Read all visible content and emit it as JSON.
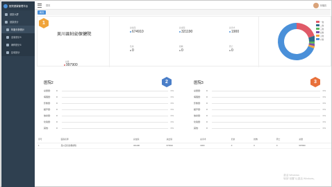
{
  "app": {
    "title": "医院健康管理平台"
  },
  "sidebar": {
    "items": [
      {
        "label": "健康大屏",
        "type": "top"
      },
      {
        "label": "健康统计",
        "type": "top"
      },
      {
        "label": "年度分析统计",
        "type": "sub",
        "active": true
      },
      {
        "label": "全量统计5",
        "type": "sub"
      },
      {
        "label": "病种统计6",
        "type": "sub"
      },
      {
        "label": "区域统计",
        "type": "sub"
      }
    ]
  },
  "topbar": {
    "tab_label": "首页",
    "user_name": "管理员"
  },
  "pagebar": {
    "active_tab": "概况"
  },
  "summary": {
    "rank": "1",
    "rank_color": "#f0a43a",
    "hospital_name": "吴川县妇幼保健院",
    "total_label": "总量",
    "total_value": "997900",
    "metrics": [
      {
        "label": "总住院",
        "value": "674910"
      },
      {
        "label": "总出院",
        "value": "321190"
      },
      {
        "label": "总手术",
        "value": "1900"
      },
      {
        "label": "危重",
        "value": "0"
      },
      {
        "label": "抢救",
        "value": "0"
      },
      {
        "label": "死亡",
        "value": "0"
      }
    ],
    "donut": {
      "segments": [
        {
          "name": "一类",
          "value": 20,
          "color": "#e05a68"
        },
        {
          "name": "二类",
          "value": 5,
          "color": "#2e6b8a"
        },
        {
          "name": "三类",
          "value": 2,
          "color": "#5ab75a"
        },
        {
          "name": "四类",
          "value": 2,
          "color": "#7b4fa8"
        },
        {
          "name": "五类",
          "value": 2,
          "color": "#f0a43a"
        },
        {
          "name": "六类",
          "value": 69,
          "color": "#4a90d9"
        }
      ]
    }
  },
  "panels": [
    {
      "title": "医院2",
      "rank": "2",
      "rank_color": "#4a7ec8",
      "rows": [
        {
          "label": "总量量",
          "value": "0",
          "pct": "0%"
        },
        {
          "label": "病理量",
          "value": "0",
          "pct": "0%"
        },
        {
          "label": "影像量",
          "value": "0",
          "pct": "0%"
        },
        {
          "label": "超声量",
          "value": "0",
          "pct": "0%"
        },
        {
          "label": "放射量",
          "value": "0",
          "pct": "0%"
        },
        {
          "label": "化验量",
          "value": "0",
          "pct": "0%"
        },
        {
          "label": "其他",
          "value": "0",
          "pct": "0%"
        }
      ]
    },
    {
      "title": "医院3",
      "rank": "3",
      "rank_color": "#e8703a",
      "rows": [
        {
          "label": "总量量",
          "value": "0",
          "pct": "0%"
        },
        {
          "label": "病理量",
          "value": "0",
          "pct": "0%"
        },
        {
          "label": "影像量",
          "value": "0",
          "pct": "0%"
        },
        {
          "label": "超声量",
          "value": "0",
          "pct": "0%"
        },
        {
          "label": "放射量",
          "value": "0",
          "pct": "0%"
        },
        {
          "label": "化验量",
          "value": "0",
          "pct": "0%"
        },
        {
          "label": "其他",
          "value": "0",
          "pct": "0%"
        }
      ]
    }
  ],
  "table": {
    "headers": [
      "序号",
      "医院名称",
      "总住院",
      "总出院",
      "总手术",
      "危重",
      "抢救",
      "死亡",
      "总量"
    ],
    "rows": [
      [
        "1",
        "吴川县妇幼保健院",
        "321190",
        "674910",
        "1900",
        "0",
        "0",
        "0",
        "997900"
      ]
    ]
  },
  "watermark": {
    "line1": "激活 Windows",
    "line2": "转到\"设置\"以激活 Windows。"
  }
}
